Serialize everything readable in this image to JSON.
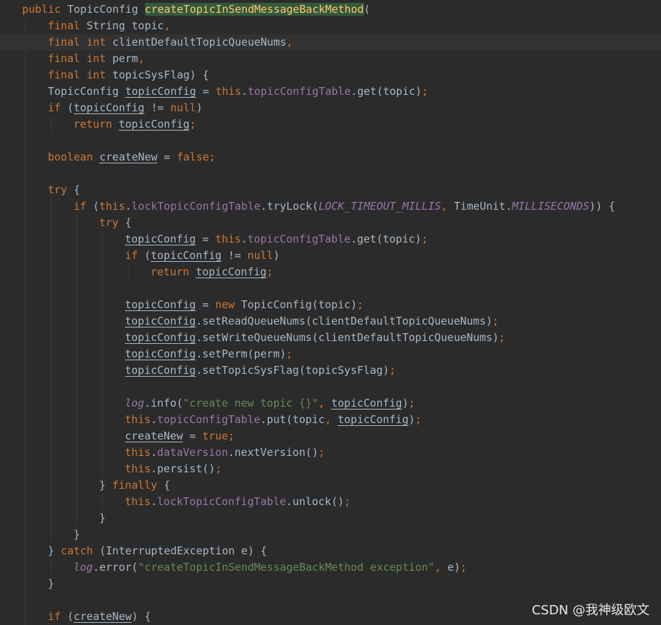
{
  "editor": {
    "lines": [
      {
        "indent": 0,
        "tokens": [
          {
            "t": "public ",
            "c": "kw"
          },
          {
            "t": "TopicConfig ",
            "c": ""
          },
          {
            "t": "createTopicInSendMessageBackMethod",
            "c": "hl"
          },
          {
            "t": "(",
            "c": ""
          }
        ]
      },
      {
        "indent": 1,
        "tokens": [
          {
            "t": "final ",
            "c": "kw"
          },
          {
            "t": "String topic",
            "c": ""
          },
          {
            "t": ",",
            "c": "kw"
          }
        ]
      },
      {
        "indent": 1,
        "current": true,
        "tokens": [
          {
            "t": "final ",
            "c": "kw"
          },
          {
            "t": "int ",
            "c": "kw"
          },
          {
            "t": "clientDefaultTopicQueueNums",
            "c": ""
          },
          {
            "t": ",",
            "c": "kw"
          }
        ]
      },
      {
        "indent": 1,
        "tokens": [
          {
            "t": "final ",
            "c": "kw"
          },
          {
            "t": "int ",
            "c": "kw"
          },
          {
            "t": "perm",
            "c": ""
          },
          {
            "t": ",",
            "c": "kw"
          }
        ]
      },
      {
        "indent": 1,
        "tokens": [
          {
            "t": "final ",
            "c": "kw"
          },
          {
            "t": "int ",
            "c": "kw"
          },
          {
            "t": "topicSysFlag) {",
            "c": ""
          }
        ]
      },
      {
        "indent": 1,
        "tokens": [
          {
            "t": "TopicConfig ",
            "c": ""
          },
          {
            "t": "topicConfig",
            "c": "ul"
          },
          {
            "t": " = ",
            "c": ""
          },
          {
            "t": "this",
            "c": "kw"
          },
          {
            "t": ".",
            "c": ""
          },
          {
            "t": "topicConfigTable",
            "c": "fld"
          },
          {
            "t": ".get(topic)",
            "c": ""
          },
          {
            "t": ";",
            "c": "kw"
          }
        ]
      },
      {
        "indent": 1,
        "tokens": [
          {
            "t": "if ",
            "c": "kw"
          },
          {
            "t": "(",
            "c": ""
          },
          {
            "t": "topicConfig",
            "c": "ul"
          },
          {
            "t": " != ",
            "c": ""
          },
          {
            "t": "null",
            "c": "kw"
          },
          {
            "t": ")",
            "c": ""
          }
        ]
      },
      {
        "indent": 2,
        "tokens": [
          {
            "t": "return ",
            "c": "kw"
          },
          {
            "t": "topicConfig",
            "c": "ul"
          },
          {
            "t": ";",
            "c": "kw"
          }
        ]
      },
      {
        "indent": 0,
        "tokens": []
      },
      {
        "indent": 1,
        "tokens": [
          {
            "t": "boolean ",
            "c": "kw"
          },
          {
            "t": "createNew",
            "c": "ul"
          },
          {
            "t": " = ",
            "c": ""
          },
          {
            "t": "false",
            "c": "kw"
          },
          {
            "t": ";",
            "c": "kw"
          }
        ]
      },
      {
        "indent": 0,
        "tokens": []
      },
      {
        "indent": 1,
        "tokens": [
          {
            "t": "try ",
            "c": "kw"
          },
          {
            "t": "{",
            "c": ""
          }
        ]
      },
      {
        "indent": 2,
        "tokens": [
          {
            "t": "if ",
            "c": "kw"
          },
          {
            "t": "(",
            "c": ""
          },
          {
            "t": "this",
            "c": "kw"
          },
          {
            "t": ".",
            "c": ""
          },
          {
            "t": "lockTopicConfigTable",
            "c": "fld"
          },
          {
            "t": ".tryLock(",
            "c": ""
          },
          {
            "t": "LOCK_TIMEOUT_MILLIS",
            "c": "stat"
          },
          {
            "t": ", ",
            "c": "kw"
          },
          {
            "t": "TimeUnit.",
            "c": ""
          },
          {
            "t": "MILLISECONDS",
            "c": "stat"
          },
          {
            "t": ")) {",
            "c": ""
          }
        ]
      },
      {
        "indent": 3,
        "tokens": [
          {
            "t": "try ",
            "c": "kw"
          },
          {
            "t": "{",
            "c": ""
          }
        ]
      },
      {
        "indent": 4,
        "tokens": [
          {
            "t": "topicConfig",
            "c": "ul"
          },
          {
            "t": " = ",
            "c": ""
          },
          {
            "t": "this",
            "c": "kw"
          },
          {
            "t": ".",
            "c": ""
          },
          {
            "t": "topicConfigTable",
            "c": "fld"
          },
          {
            "t": ".get(topic)",
            "c": ""
          },
          {
            "t": ";",
            "c": "kw"
          }
        ]
      },
      {
        "indent": 4,
        "tokens": [
          {
            "t": "if ",
            "c": "kw"
          },
          {
            "t": "(",
            "c": ""
          },
          {
            "t": "topicConfig",
            "c": "ul"
          },
          {
            "t": " != ",
            "c": ""
          },
          {
            "t": "null",
            "c": "kw"
          },
          {
            "t": ")",
            "c": ""
          }
        ]
      },
      {
        "indent": 5,
        "tokens": [
          {
            "t": "return ",
            "c": "kw"
          },
          {
            "t": "topicConfig",
            "c": "ul"
          },
          {
            "t": ";",
            "c": "kw"
          }
        ]
      },
      {
        "indent": 0,
        "tokens": []
      },
      {
        "indent": 4,
        "tokens": [
          {
            "t": "topicConfig",
            "c": "ul"
          },
          {
            "t": " = ",
            "c": ""
          },
          {
            "t": "new ",
            "c": "kw"
          },
          {
            "t": "TopicConfig(topic)",
            "c": ""
          },
          {
            "t": ";",
            "c": "kw"
          }
        ]
      },
      {
        "indent": 4,
        "tokens": [
          {
            "t": "topicConfig",
            "c": "ul"
          },
          {
            "t": ".setReadQueueNums(clientDefaultTopicQueueNums)",
            "c": ""
          },
          {
            "t": ";",
            "c": "kw"
          }
        ]
      },
      {
        "indent": 4,
        "tokens": [
          {
            "t": "topicConfig",
            "c": "ul"
          },
          {
            "t": ".setWriteQueueNums(clientDefaultTopicQueueNums)",
            "c": ""
          },
          {
            "t": ";",
            "c": "kw"
          }
        ]
      },
      {
        "indent": 4,
        "tokens": [
          {
            "t": "topicConfig",
            "c": "ul"
          },
          {
            "t": ".setPerm(perm)",
            "c": ""
          },
          {
            "t": ";",
            "c": "kw"
          }
        ]
      },
      {
        "indent": 4,
        "tokens": [
          {
            "t": "topicConfig",
            "c": "ul"
          },
          {
            "t": ".setTopicSysFlag(topicSysFlag)",
            "c": ""
          },
          {
            "t": ";",
            "c": "kw"
          }
        ]
      },
      {
        "indent": 0,
        "tokens": []
      },
      {
        "indent": 4,
        "tokens": [
          {
            "t": "log",
            "c": "stat"
          },
          {
            "t": ".info(",
            "c": ""
          },
          {
            "t": "\"create new topic {}\"",
            "c": "str"
          },
          {
            "t": ", ",
            "c": "kw"
          },
          {
            "t": "topicConfig",
            "c": "ul"
          },
          {
            "t": ")",
            "c": ""
          },
          {
            "t": ";",
            "c": "kw"
          }
        ]
      },
      {
        "indent": 4,
        "tokens": [
          {
            "t": "this",
            "c": "kw"
          },
          {
            "t": ".",
            "c": ""
          },
          {
            "t": "topicConfigTable",
            "c": "fld"
          },
          {
            "t": ".put(topic",
            "c": ""
          },
          {
            "t": ", ",
            "c": "kw"
          },
          {
            "t": "topicConfig",
            "c": "ul"
          },
          {
            "t": ")",
            "c": ""
          },
          {
            "t": ";",
            "c": "kw"
          }
        ]
      },
      {
        "indent": 4,
        "tokens": [
          {
            "t": "createNew",
            "c": "ul"
          },
          {
            "t": " = ",
            "c": ""
          },
          {
            "t": "true",
            "c": "kw"
          },
          {
            "t": ";",
            "c": "kw"
          }
        ]
      },
      {
        "indent": 4,
        "tokens": [
          {
            "t": "this",
            "c": "kw"
          },
          {
            "t": ".",
            "c": ""
          },
          {
            "t": "dataVersion",
            "c": "fld"
          },
          {
            "t": ".nextVersion()",
            "c": ""
          },
          {
            "t": ";",
            "c": "kw"
          }
        ]
      },
      {
        "indent": 4,
        "tokens": [
          {
            "t": "this",
            "c": "kw"
          },
          {
            "t": ".persist()",
            "c": ""
          },
          {
            "t": ";",
            "c": "kw"
          }
        ]
      },
      {
        "indent": 3,
        "tokens": [
          {
            "t": "} ",
            "c": ""
          },
          {
            "t": "finally ",
            "c": "kw"
          },
          {
            "t": "{",
            "c": ""
          }
        ]
      },
      {
        "indent": 4,
        "tokens": [
          {
            "t": "this",
            "c": "kw"
          },
          {
            "t": ".",
            "c": ""
          },
          {
            "t": "lockTopicConfigTable",
            "c": "fld"
          },
          {
            "t": ".unlock()",
            "c": ""
          },
          {
            "t": ";",
            "c": "kw"
          }
        ]
      },
      {
        "indent": 3,
        "tokens": [
          {
            "t": "}",
            "c": ""
          }
        ]
      },
      {
        "indent": 2,
        "tokens": [
          {
            "t": "}",
            "c": ""
          }
        ]
      },
      {
        "indent": 1,
        "tokens": [
          {
            "t": "} ",
            "c": ""
          },
          {
            "t": "catch ",
            "c": "kw"
          },
          {
            "t": "(InterruptedException e) {",
            "c": ""
          }
        ]
      },
      {
        "indent": 2,
        "tokens": [
          {
            "t": "log",
            "c": "stat"
          },
          {
            "t": ".error(",
            "c": ""
          },
          {
            "t": "\"createTopicInSendMessageBackMethod exception\"",
            "c": "str"
          },
          {
            "t": ", ",
            "c": "kw"
          },
          {
            "t": "e)",
            "c": ""
          },
          {
            "t": ";",
            "c": "kw"
          }
        ]
      },
      {
        "indent": 1,
        "tokens": [
          {
            "t": "}",
            "c": ""
          }
        ]
      },
      {
        "indent": 0,
        "tokens": []
      },
      {
        "indent": 1,
        "tokens": [
          {
            "t": "if ",
            "c": "kw"
          },
          {
            "t": "(",
            "c": ""
          },
          {
            "t": "createNew",
            "c": "ul"
          },
          {
            "t": ") {",
            "c": ""
          }
        ]
      }
    ]
  },
  "watermark": "CSDN @我神级欧文",
  "colors": {
    "background": "#2b2b2b",
    "current_line": "#323232",
    "keyword": "#cc7832",
    "field": "#9876aa",
    "string": "#6a8759",
    "method_highlight_bg": "#32593d",
    "method_highlight_fg": "#ffc66d",
    "text": "#a9b7c6"
  }
}
